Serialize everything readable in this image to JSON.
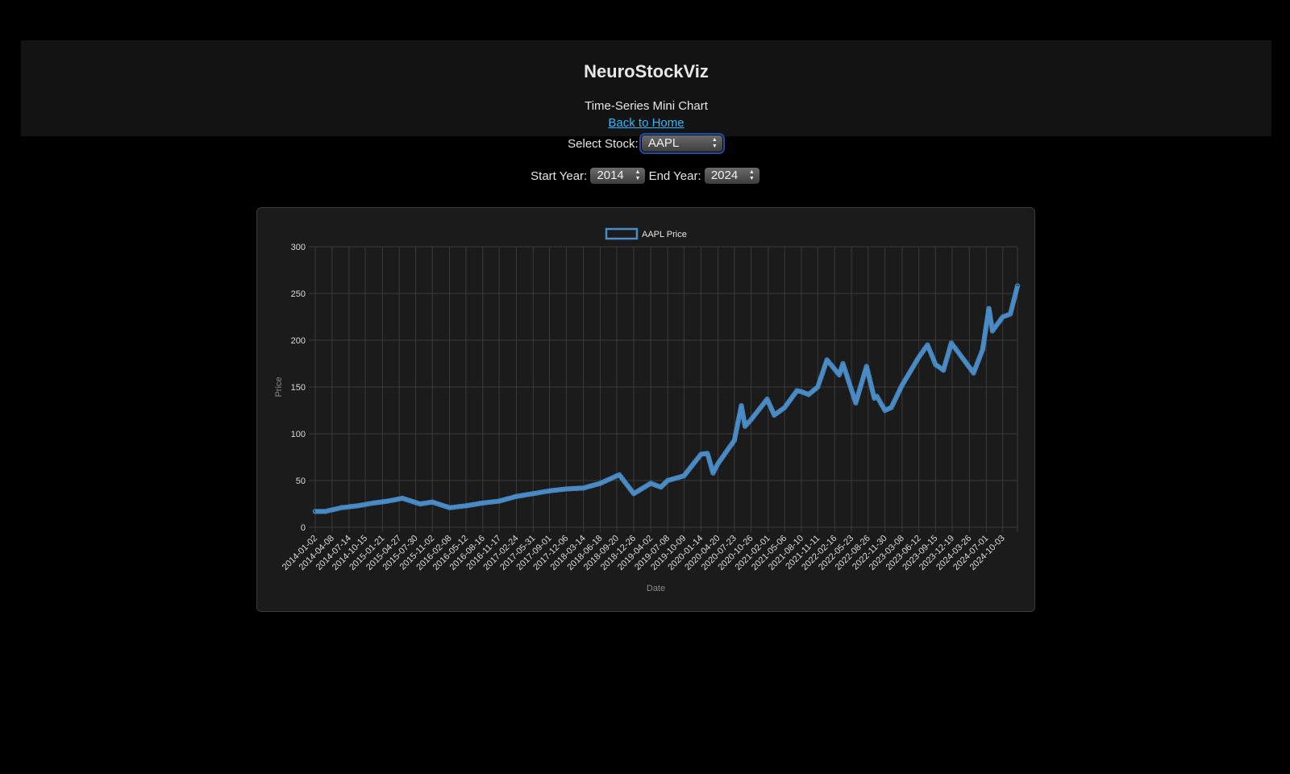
{
  "header": {
    "title": "NeuroStockViz",
    "subtitle": "Time-Series Mini Chart",
    "home_link": "Back to Home"
  },
  "controls": {
    "stock_label": "Select Stock:",
    "stock_value": "AAPL",
    "start_label": "Start Year:",
    "start_value": "2014",
    "end_label": "End Year:",
    "end_value": "2024"
  },
  "colors": {
    "line": "#4a8cc7",
    "accent_link": "#2fb6ff",
    "card_bg": "#1b1b1b"
  },
  "chart_data": {
    "type": "line",
    "legend": "AAPL Price",
    "xlabel": "Date",
    "ylabel": "Price",
    "ylim": [
      0,
      300
    ],
    "yticks": [
      0,
      50,
      100,
      150,
      200,
      250,
      300
    ],
    "grid": true,
    "legend_position": "top",
    "x_tick_labels": [
      "2014-01-02",
      "2014-04-08",
      "2014-07-14",
      "2014-10-15",
      "2015-01-21",
      "2015-04-27",
      "2015-07-30",
      "2015-11-02",
      "2016-02-08",
      "2016-05-12",
      "2016-08-16",
      "2016-11-17",
      "2017-02-24",
      "2017-05-31",
      "2017-09-01",
      "2017-12-06",
      "2018-03-14",
      "2018-06-18",
      "2018-09-20",
      "2018-12-26",
      "2019-04-02",
      "2019-07-08",
      "2019-10-09",
      "2020-01-14",
      "2020-04-20",
      "2020-07-23",
      "2020-10-26",
      "2021-02-01",
      "2021-05-06",
      "2021-08-10",
      "2021-11-11",
      "2022-02-16",
      "2022-05-23",
      "2022-08-26",
      "2022-11-30",
      "2023-03-08",
      "2023-06-12",
      "2023-09-15",
      "2023-12-19",
      "2024-03-26",
      "2024-07-01",
      "2024-10-03"
    ],
    "series": [
      {
        "name": "AAPL Price",
        "x": [
          "2014-01-02",
          "2014-03-01",
          "2014-06-01",
          "2014-09-01",
          "2014-12-01",
          "2015-02-20",
          "2015-05-15",
          "2015-08-24",
          "2015-11-02",
          "2016-02-08",
          "2016-05-12",
          "2016-08-16",
          "2016-11-17",
          "2017-02-24",
          "2017-05-31",
          "2017-09-01",
          "2017-12-06",
          "2018-03-14",
          "2018-06-18",
          "2018-09-20",
          "2018-10-05",
          "2018-12-26",
          "2019-04-02",
          "2019-05-30",
          "2019-07-08",
          "2019-10-09",
          "2020-01-14",
          "2020-02-20",
          "2020-03-23",
          "2020-04-20",
          "2020-07-23",
          "2020-09-01",
          "2020-09-22",
          "2020-10-26",
          "2021-01-26",
          "2021-03-08",
          "2021-05-06",
          "2021-07-15",
          "2021-08-10",
          "2021-09-20",
          "2021-11-11",
          "2022-01-03",
          "2022-03-14",
          "2022-04-04",
          "2022-06-16",
          "2022-08-17",
          "2022-09-30",
          "2022-10-15",
          "2022-11-30",
          "2023-01-05",
          "2023-03-08",
          "2023-06-12",
          "2023-07-31",
          "2023-09-15",
          "2023-10-30",
          "2023-12-14",
          "2024-01-31",
          "2024-04-19",
          "2024-06-10",
          "2024-07-01",
          "2024-07-16",
          "2024-08-05",
          "2024-10-03",
          "2024-11-15",
          "2024-12-26"
        ],
        "values": [
          17,
          17,
          21,
          23,
          26,
          28,
          31,
          25,
          27,
          21,
          23,
          26,
          28,
          33,
          36,
          39,
          41,
          42,
          47,
          55,
          56,
          36,
          47,
          43,
          50,
          55,
          78,
          79,
          58,
          68,
          93,
          130,
          108,
          115,
          137,
          120,
          128,
          146,
          145,
          142,
          150,
          179,
          163,
          175,
          133,
          172,
          138,
          140,
          125,
          128,
          152,
          182,
          195,
          174,
          168,
          197,
          185,
          165,
          190,
          216,
          234,
          210,
          225,
          228,
          258
        ]
      }
    ]
  }
}
